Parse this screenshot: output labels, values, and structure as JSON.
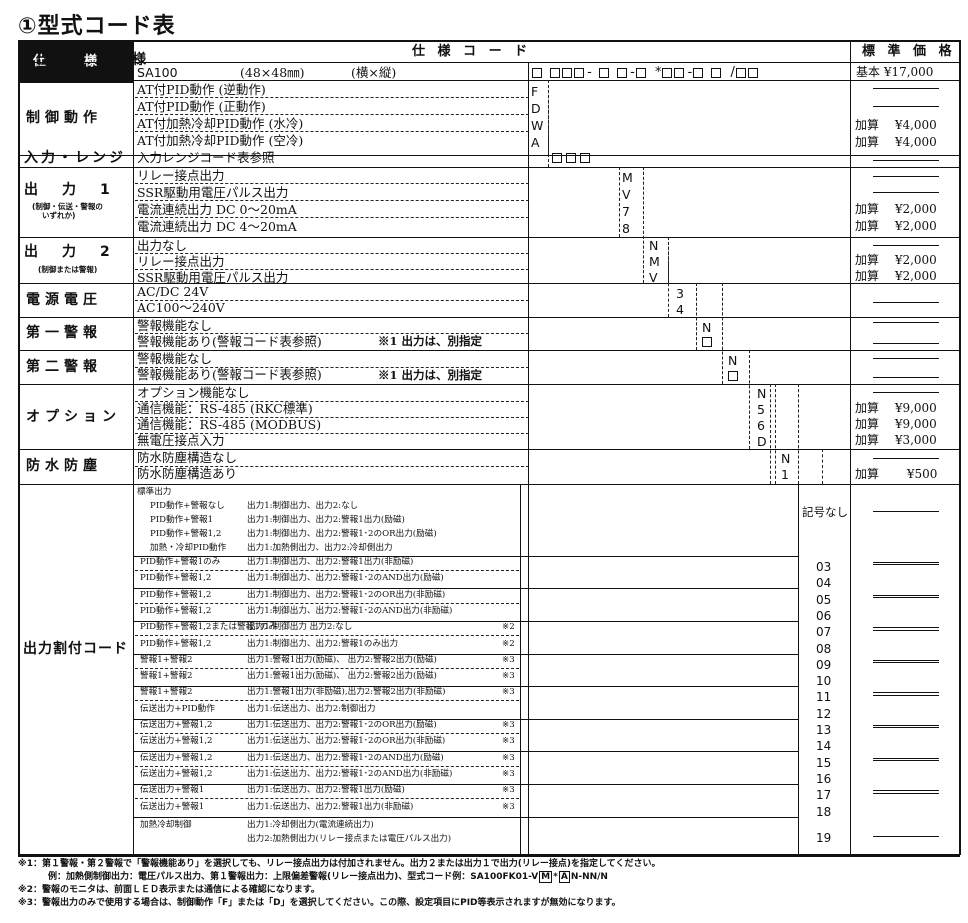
{
  "title": "①型式コード表",
  "header": {
    "spec": "仕　　様",
    "spec_code": "仕 様 コ ー ド",
    "price": "標 準 価 格",
    "model": "SA100",
    "size": "(48×48㎜)",
    "orient": "(横×縦)",
    "base_price": "基本 ¥17,000"
  },
  "sections": {
    "ctrl": {
      "label": "制御動作",
      "items": [
        "AT付PID動作 (逆動作)",
        "AT付PID動作 (正動作)",
        "AT付加熱冷却PID動作 (水冷)",
        "AT付加熱冷却PID動作 (空冷)"
      ],
      "codes": [
        "F",
        "D",
        "W",
        "A"
      ],
      "prices": [
        "",
        "",
        "加算　 ¥4,000",
        "加算　 ¥4,000"
      ]
    },
    "input": {
      "label": "入力・レンジ",
      "items": [
        "入力レンジコード表参照"
      ]
    },
    "out1": {
      "label": "出　力　1",
      "sub": "(制御・伝送・警報の\nいずれか)",
      "items": [
        "リレー接点出力",
        "SSR駆動用電圧パルス出力",
        "電流連続出力 DC 0〜20mA",
        "電流連続出力 DC 4〜20mA"
      ],
      "codes": [
        "M",
        "V",
        "7",
        "8"
      ],
      "prices": [
        "",
        "",
        "加算　 ¥2,000",
        "加算　 ¥2,000"
      ]
    },
    "out2": {
      "label": "出　力　2",
      "sub": "(制御または警報)",
      "items": [
        "出力なし",
        "リレー接点出力",
        "SSR駆動用電圧パルス出力"
      ],
      "codes": [
        "N",
        "M",
        "V"
      ],
      "prices": [
        "",
        "加算　 ¥2,000",
        "加算　 ¥2,000"
      ]
    },
    "power": {
      "label": "電源電圧",
      "items": [
        "AC/DC 24V",
        "AC100〜240V"
      ],
      "codes": [
        "3",
        "4"
      ]
    },
    "alarm1": {
      "label": "第一警報",
      "items": [
        "警報機能なし",
        "警報機能あり(警報コード表参照)"
      ],
      "note": "※1 出力は、別指定",
      "codes": [
        "N",
        ""
      ]
    },
    "alarm2": {
      "label": "第二警報",
      "items": [
        "警報機能なし",
        "警報機能あり(警報コード表参照)"
      ],
      "note": "※1 出力は、別指定",
      "codes": [
        "N",
        ""
      ]
    },
    "option": {
      "label": "オプション",
      "items": [
        "オプション機能なし",
        "通信機能：RS-485 (RKC標準)",
        "通信機能：RS-485 (MODBUS)",
        "無電圧接点入力"
      ],
      "codes": [
        "N",
        "5",
        "6",
        "D"
      ],
      "prices": [
        "",
        "加算　 ¥9,000",
        "加算　 ¥9,000",
        "加算　 ¥3,000"
      ]
    },
    "water": {
      "label": "防水防塵",
      "items": [
        "防水防塵構造なし",
        "防水防塵構造あり"
      ],
      "codes": [
        "N",
        "1"
      ],
      "prices": [
        "",
        "加算　　 ¥500"
      ]
    },
    "assign": {
      "label": "出力割付コード",
      "std_title": "標準出力",
      "std": [
        [
          "PID動作+警報なし",
          "出力1:制御出力、出力2:なし"
        ],
        [
          "PID動作+警報1",
          "出力1:制御出力、出力2:警報1出力(励磁)"
        ],
        [
          "PID動作+警報1,2",
          "出力1:制御出力、出力2:警報1･2のOR出力(励磁)"
        ],
        [
          "加熱・冷却PID動作",
          "出力1:加熱側出力、出力2:冷却側出力"
        ]
      ],
      "std_code": "記号なし",
      "rows": [
        [
          "PID動作+警報1のみ",
          "出力1:制御出力、出力2:警報1出力(非励磁)",
          "",
          "03"
        ],
        [
          "PID動作+警報1,2",
          "出力1:制御出力、出力2:警報1･2のAND出力(励磁)",
          "",
          "04"
        ],
        [
          "PID動作+警報1,2",
          "出力1:制御出力、出力2:警報1･2のOR出力(非励磁)",
          "",
          "05"
        ],
        [
          "PID動作+警報1,2",
          "出力1:制御出力、出力2:警報1･2のAND出力(非励磁)",
          "",
          "06"
        ],
        [
          "PID動作+警報1,2または警報1のみ",
          "出力1:制御出力 出力2:なし",
          "※2",
          "07"
        ],
        [
          "PID動作+警報1,2",
          "出力1:制御出力、出力2:警報1のみ出力",
          "※2",
          "08"
        ],
        [
          "警報1+警報2",
          "出力1:警報1出力(励磁)、 出力2:警報2出力(励磁)",
          "※3",
          "09"
        ],
        [
          "警報1+警報2",
          "出力1:警報1出力(励磁)、 出力2:警報2出力(励磁)",
          "※3",
          "10"
        ],
        [
          "警報1+警報2",
          "出力1:警報1出力(非励磁),出力2:警報2出力(非励磁)",
          "※3",
          "11"
        ],
        [
          "伝送出力+PID動作",
          "出力1:伝送出力、出力2:制御出力",
          "",
          "12"
        ],
        [
          "伝送出力+警報1,2",
          "出力1:伝送出力、出力2:警報1･2のOR出力(励磁)",
          "※3",
          "13"
        ],
        [
          "伝送出力+警報1,2",
          "出力1:伝送出力、出力2:警報1･2のOR出力(非励磁)",
          "※3",
          "14"
        ],
        [
          "伝送出力+警報1,2",
          "出力1:伝送出力、出力2:警報1･2のAND出力(励磁)",
          "※3",
          "15"
        ],
        [
          "伝送出力+警報1,2",
          "出力1:伝送出力、出力2:警報1･2のAND出力(非励磁)",
          "※3",
          "16"
        ],
        [
          "伝送出力+警報1",
          "出力1:伝送出力、出力2:警報1出力(励磁)",
          "※3",
          "17"
        ],
        [
          "伝送出力+警報1",
          "出力1:伝送出力、出力2:警報1出力(非励磁)",
          "※3",
          "18"
        ]
      ],
      "last": [
        "加熱冷却制御",
        "出力1:冷却側出力(電流連続出力)",
        "出力2:加熱側出力(リレー接点または電圧パルス出力)"
      ],
      "last_code": "19"
    }
  },
  "footnotes": [
    "※1：第１警報・第２警報で「警報機能あり」を選択しても、リレー接点出力は付加されません。出力２または出力１で出力(リレー接点)を指定してください。",
    "例：加熱側制御出力：電圧パルス出力、第１警報出力：上限偏差警報(リレー接点出力)、型式コード例：SA100FK01-V",
    "*",
    "N-NN/N",
    "※2：警報のモニタは、前面ＬＥＤ表示または通信による確認になります。",
    "※3：警報出力のみで使用する場合は、制御動作「F」または「D」を選択してください。この際、設定項目にPID等表示されますが無効になります。"
  ],
  "fn_box": [
    "M",
    "A"
  ]
}
